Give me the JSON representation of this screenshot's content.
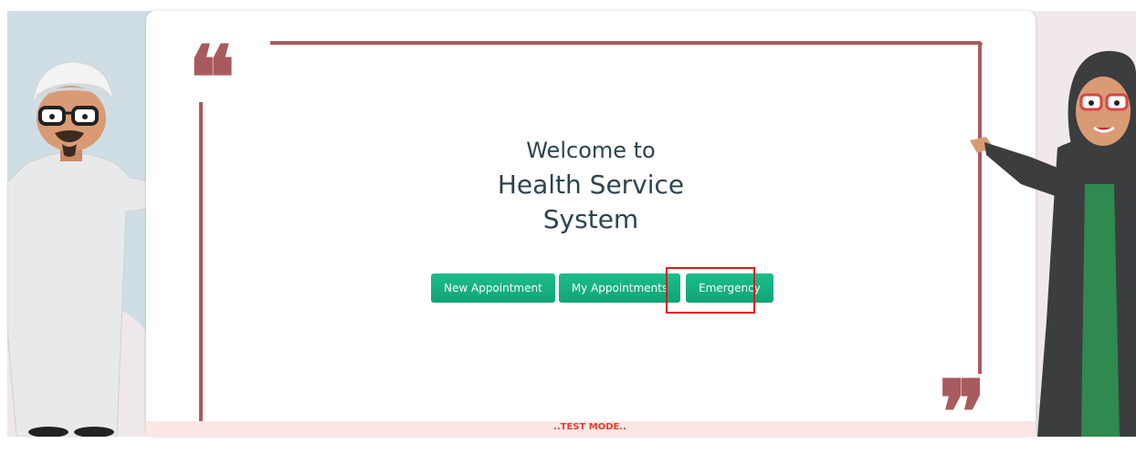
{
  "welcome": {
    "line1": "Welcome to",
    "line2": "Health Service",
    "line3": "System"
  },
  "buttons": {
    "new_appointment": "New Appointment",
    "my_appointments": "My Appointments",
    "emergency": "Emergency"
  },
  "quotes": {
    "open": "❝",
    "close": "❞"
  },
  "status": {
    "test_mode": "..TEST MODE.."
  },
  "colors": {
    "accent_green": "#17b383",
    "frame": "#a85b5d",
    "heading": "#2d4350",
    "highlight": "#e01a1a",
    "test_mode": "#e2402f"
  }
}
